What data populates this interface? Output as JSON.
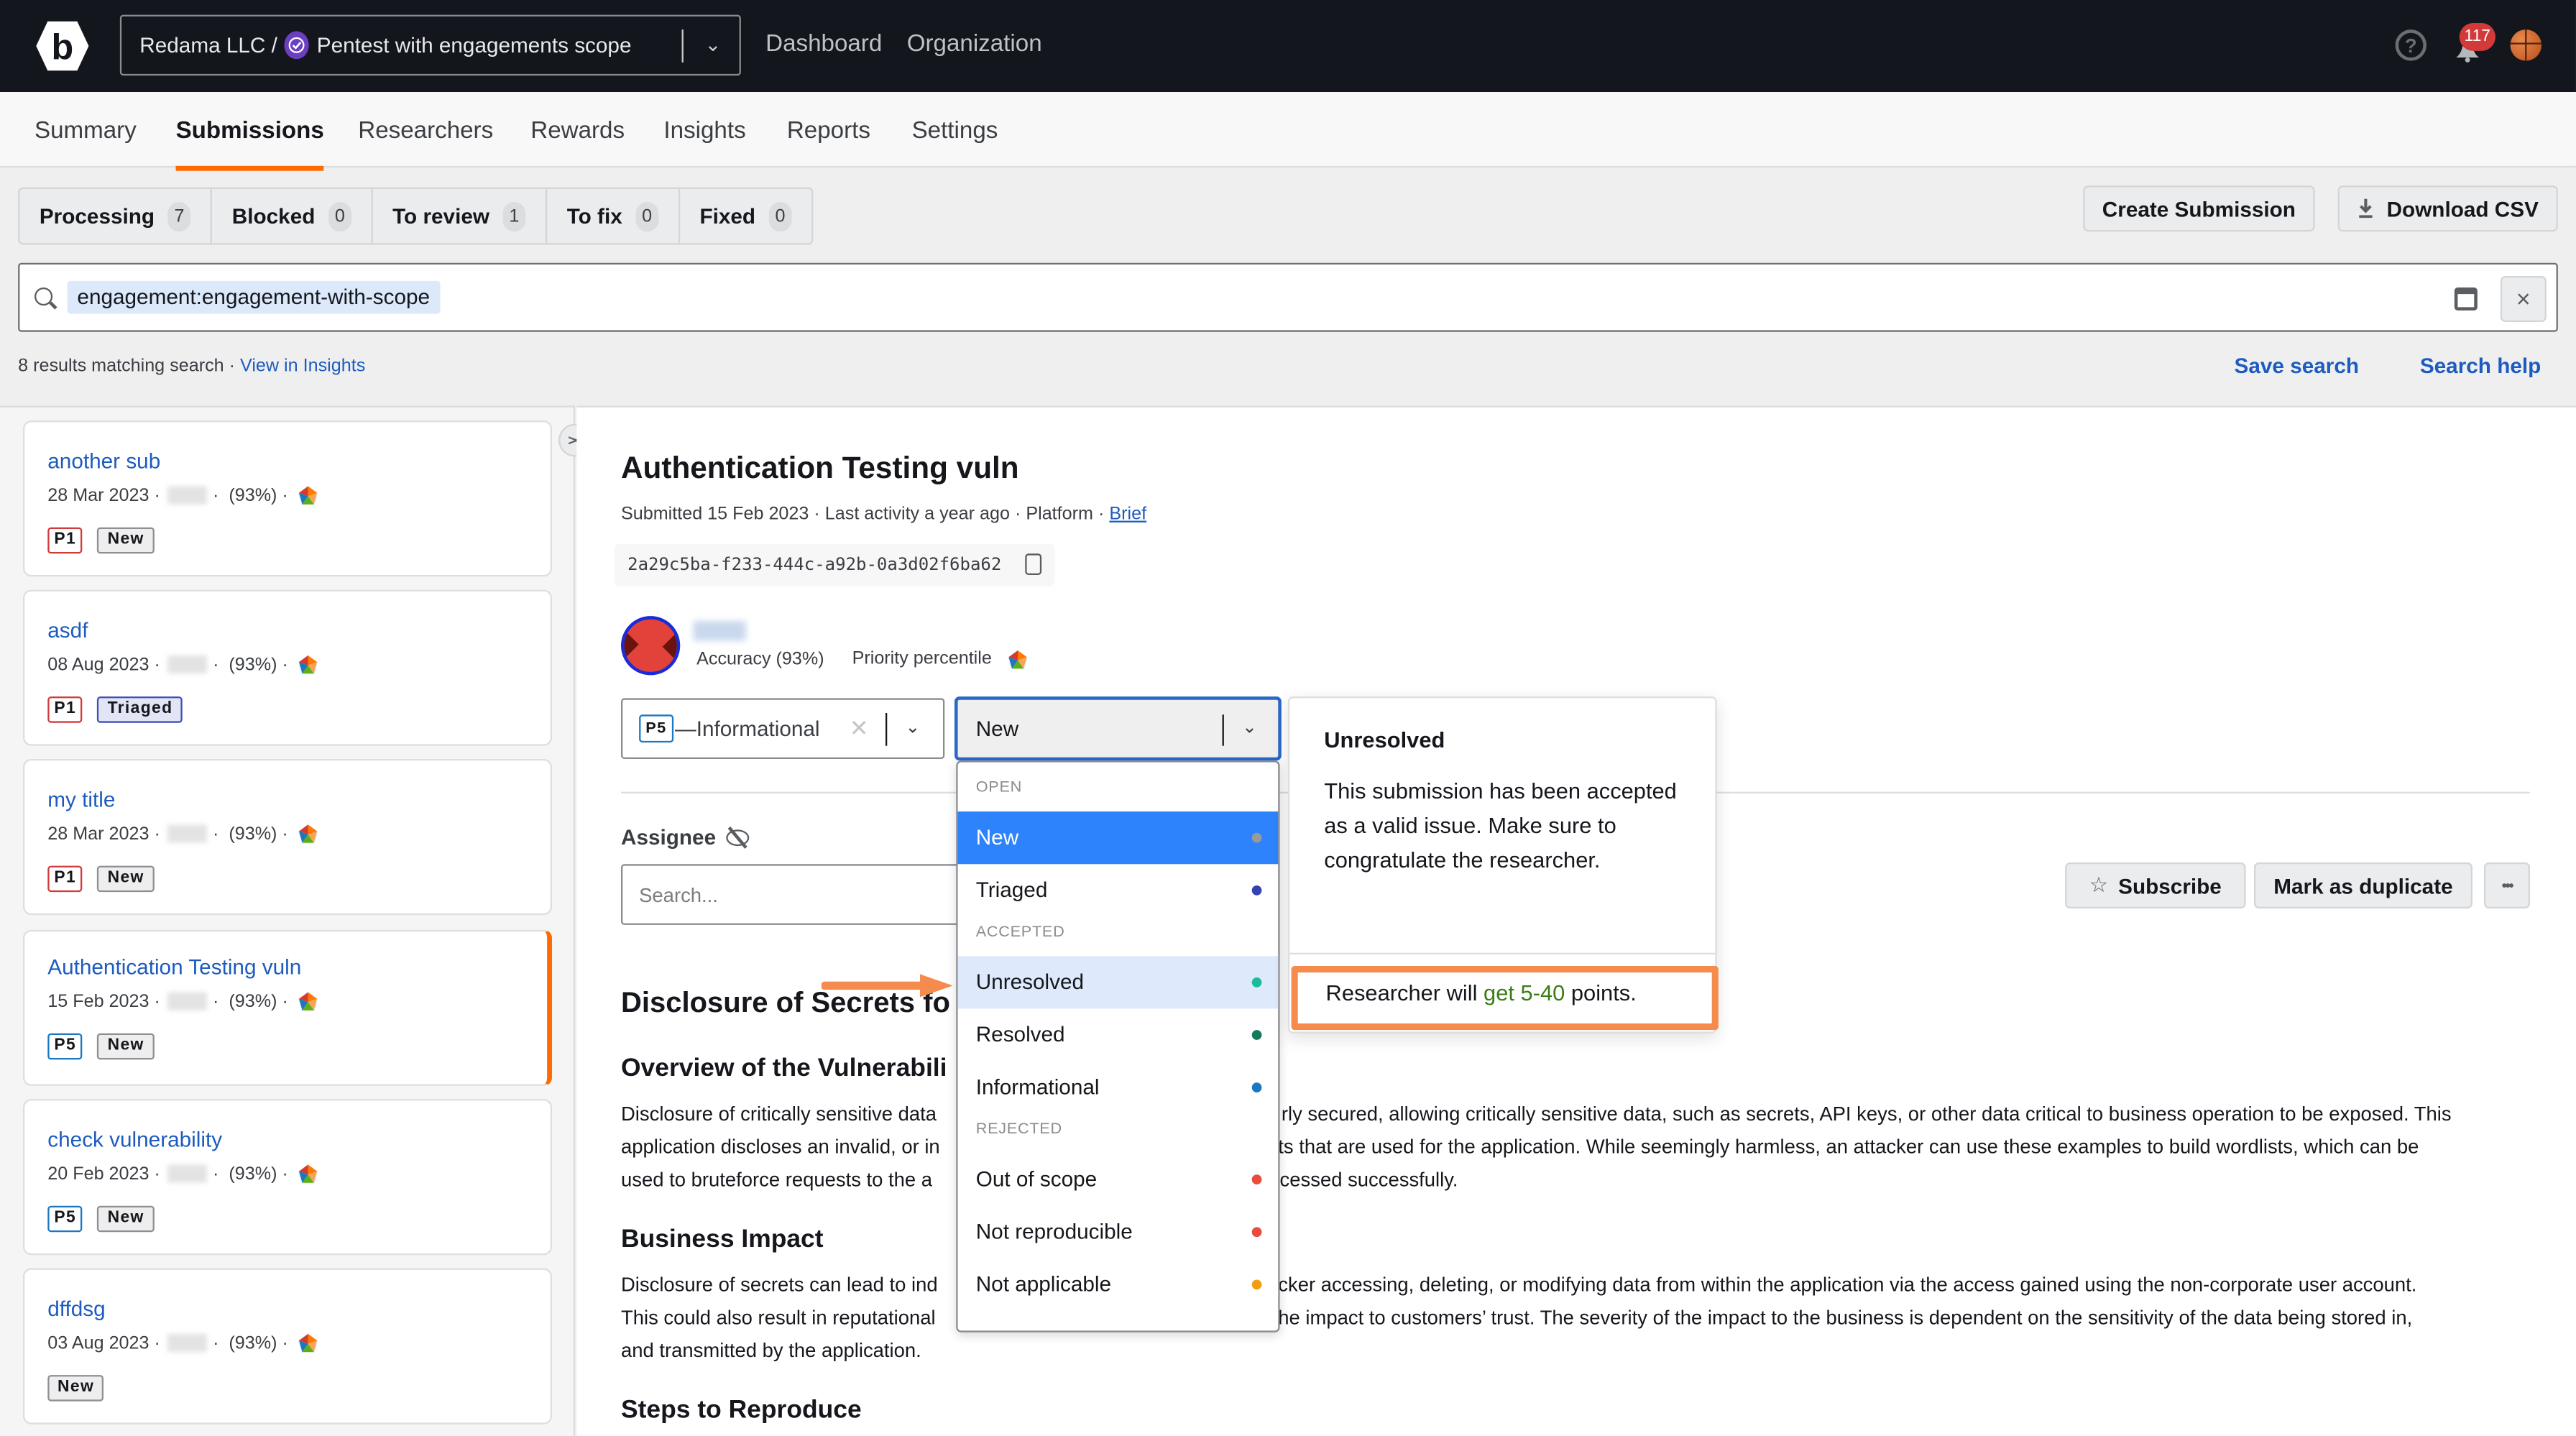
{
  "topbar": {
    "org": "Redama LLC /",
    "program": "Pentest with engagements scope",
    "nav": [
      "Dashboard",
      "Organization"
    ],
    "notification_count": "117",
    "help_icon": "help-circle-icon",
    "bell_icon": "bell-icon",
    "avatar_icon": "basketball-avatar"
  },
  "subnav": {
    "tabs": [
      "Summary",
      "Submissions",
      "Researchers",
      "Rewards",
      "Insights",
      "Reports",
      "Settings"
    ],
    "active": "Submissions"
  },
  "status_tabs": [
    {
      "label": "Processing",
      "count": "7"
    },
    {
      "label": "Blocked",
      "count": "0"
    },
    {
      "label": "To review",
      "count": "1"
    },
    {
      "label": "To fix",
      "count": "0"
    },
    {
      "label": "Fixed",
      "count": "0"
    }
  ],
  "actions": {
    "create_submission": "Create Submission",
    "download_csv": "Download CSV"
  },
  "search": {
    "query_chip": "engagement:engagement-with-scope",
    "results_text": "8 results matching search",
    "view_in_insights": "View in Insights",
    "save_search": "Save search",
    "search_help": "Search help",
    "clear": "×"
  },
  "submissions": [
    {
      "title": "another sub",
      "date": "28 Mar 2023",
      "accuracy": "(93%)",
      "priority": "P1",
      "status": "New",
      "active": false
    },
    {
      "title": "asdf",
      "date": "08 Aug 2023",
      "accuracy": "(93%)",
      "priority": "P1",
      "status": "Triaged",
      "active": false
    },
    {
      "title": "my title",
      "date": "28 Mar 2023",
      "accuracy": "(93%)",
      "priority": "P1",
      "status": "New",
      "active": false
    },
    {
      "title": "Authentication Testing vuln",
      "date": "15 Feb 2023",
      "accuracy": "(93%)",
      "priority": "P5",
      "status": "New",
      "active": true
    },
    {
      "title": "check vulnerability",
      "date": "20 Feb 2023",
      "accuracy": "(93%)",
      "priority": "P5",
      "status": "New",
      "active": false
    },
    {
      "title": "dffdsg",
      "date": "03 Aug 2023",
      "accuracy": "(93%)",
      "priority": "",
      "status": "New",
      "active": false
    }
  ],
  "detail": {
    "title": "Authentication Testing vuln",
    "submitted": "Submitted 15 Feb 2023",
    "last_activity": "Last activity a year ago",
    "source": "Platform",
    "brief_link": "Brief",
    "uuid": "2a29c5ba-f233-444c-a92b-0a3d02f6ba62",
    "accuracy": "Accuracy (93%)",
    "priority_percentile": "Priority percentile",
    "severity": {
      "badge": "P5",
      "label": "—Informational"
    },
    "status_value": "New",
    "assignee_label": "Assignee",
    "assignee_placeholder": "Search...",
    "subscribe": "Subscribe",
    "mark_duplicate": "Mark as duplicate",
    "more": "•••"
  },
  "document": {
    "heading": "Disclosure of Secrets fo",
    "overview_heading": "Overview of the Vulnerabili",
    "overview_lines": [
      "Disclosure of critically sensitive data",
      "application discloses an invalid, or in",
      "used to bruteforce requests to the a"
    ],
    "overview_right_lines": [
      "rly secured, allowing critically sensitive data, such as secrets, API keys, or other data critical to business operation to be exposed. This",
      "ts that are used for the application. While seemingly harmless, an attacker can use these examples to build wordlists, which can be",
      "cessed successfully."
    ],
    "impact_heading": "Business Impact",
    "impact_lines": [
      "Disclosure of secrets can lead to ind",
      "This could also result in reputational",
      "and transmitted by the application."
    ],
    "impact_right_lines": [
      "cker accessing, deleting, or modifying data from within the application via the access gained using the non-corporate user account.",
      "he impact to customers’ trust. The severity of the impact to the business is dependent on the sensitivity of the data being stored in,"
    ],
    "steps_heading": "Steps to Reproduce"
  },
  "status_dropdown": {
    "groups": [
      {
        "label": "OPEN",
        "items": [
          {
            "label": "New",
            "color": "#9a9a9a",
            "state": "selected"
          },
          {
            "label": "Triaged",
            "color": "#3443b0",
            "state": ""
          }
        ]
      },
      {
        "label": "ACCEPTED",
        "items": [
          {
            "label": "Unresolved",
            "color": "#1abc9c",
            "state": "hover"
          },
          {
            "label": "Resolved",
            "color": "#137a5c",
            "state": ""
          },
          {
            "label": "Informational",
            "color": "#1a78c2",
            "state": ""
          }
        ]
      },
      {
        "label": "REJECTED",
        "items": [
          {
            "label": "Out of scope",
            "color": "#e74c3c",
            "state": ""
          },
          {
            "label": "Not reproducible",
            "color": "#e74c3c",
            "state": ""
          },
          {
            "label": "Not applicable",
            "color": "#f39c12",
            "state": ""
          }
        ]
      }
    ]
  },
  "tooltip": {
    "title": "Unresolved",
    "body": "This submission has been accepted as a valid issue. Make sure to congratulate the researcher.",
    "points_prefix": "Researcher will ",
    "points_highlight": "get 5-40",
    "points_suffix": " points."
  },
  "colors": {
    "accent": "#ff6b00",
    "link": "#1d5bbf",
    "annotation": "#f58c4e",
    "selected_item": "#2d83fb"
  }
}
